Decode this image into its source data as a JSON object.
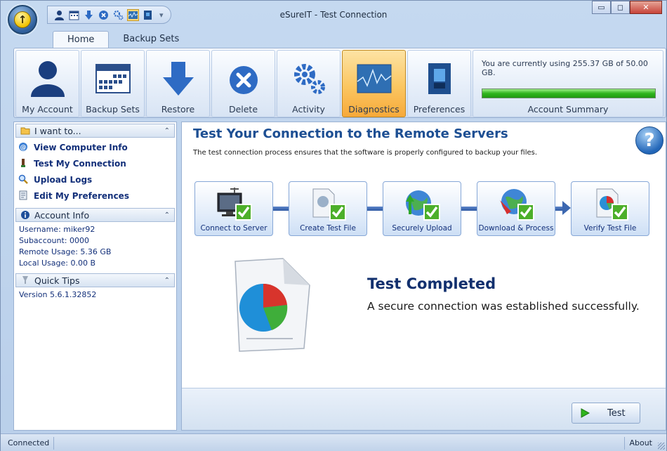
{
  "window": {
    "title": "eSureIT - Test Connection",
    "orb_icon": "up-arrow-icon",
    "controls": [
      "minimize-icon",
      "maximize-icon",
      "close-icon"
    ]
  },
  "quick_access": [
    "user-icon",
    "calendar-icon",
    "download-icon",
    "delete-icon",
    "gears-icon",
    "diagnostics-icon",
    "preferences-icon"
  ],
  "tabs": [
    {
      "label": "Home",
      "active": true
    },
    {
      "label": "Backup Sets",
      "active": false
    }
  ],
  "ribbon": {
    "buttons": [
      {
        "label": "My Account",
        "icon": "user-icon"
      },
      {
        "label": "Backup Sets",
        "icon": "calendar-icon"
      },
      {
        "label": "Restore",
        "icon": "download-arrow-icon"
      },
      {
        "label": "Delete",
        "icon": "delete-icon"
      },
      {
        "label": "Activity",
        "icon": "gears-icon"
      },
      {
        "label": "Diagnostics",
        "icon": "diagnostics-icon",
        "active": true
      },
      {
        "label": "Preferences",
        "icon": "preferences-icon"
      }
    ],
    "summary": {
      "text": "You are currently using 255.37 GB of 50.00 GB.",
      "usage_fraction": 1.0,
      "label": "Account Summary"
    }
  },
  "sidebar": {
    "i_want_to": {
      "title": "I want to...",
      "links": [
        {
          "label": "View Computer Info",
          "icon": "info-icon"
        },
        {
          "label": "Test My Connection",
          "icon": "connection-icon"
        },
        {
          "label": "Upload Logs",
          "icon": "magnifier-icon"
        },
        {
          "label": "Edit My Preferences",
          "icon": "preferences-icon"
        }
      ]
    },
    "account_info": {
      "title": "Account Info",
      "lines": [
        "Username: miker92",
        "Subaccount: 0000",
        "Remote Usage: 5.36 GB",
        "Local Usage: 0.00 B"
      ]
    },
    "quick_tips": {
      "title": "Quick Tips",
      "lines": [
        "Version 5.6.1.32852"
      ]
    }
  },
  "main": {
    "title": "Test Your Connection to the Remote Servers",
    "description": "The test connection process ensures that the software is properly configured to backup your files.",
    "steps": [
      {
        "label": "Connect to Server",
        "icon": "computer-icon",
        "complete": true
      },
      {
        "label": "Create Test File",
        "icon": "file-icon",
        "complete": true
      },
      {
        "label": "Securely Upload",
        "icon": "upload-globe-icon",
        "complete": true
      },
      {
        "label": "Download & Process",
        "icon": "download-globe-icon",
        "complete": true
      },
      {
        "label": "Verify Test File",
        "icon": "pie-file-icon",
        "complete": true
      }
    ],
    "result": {
      "title": "Test Completed",
      "message": "A secure connection was established successfully."
    },
    "test_button": "Test"
  },
  "statusbar": {
    "left": "Connected",
    "right": "About"
  },
  "colors": {
    "accent": "#1d4f93",
    "link": "#13307a",
    "active_button": "#fbc661",
    "progress": "#2fb51e"
  }
}
